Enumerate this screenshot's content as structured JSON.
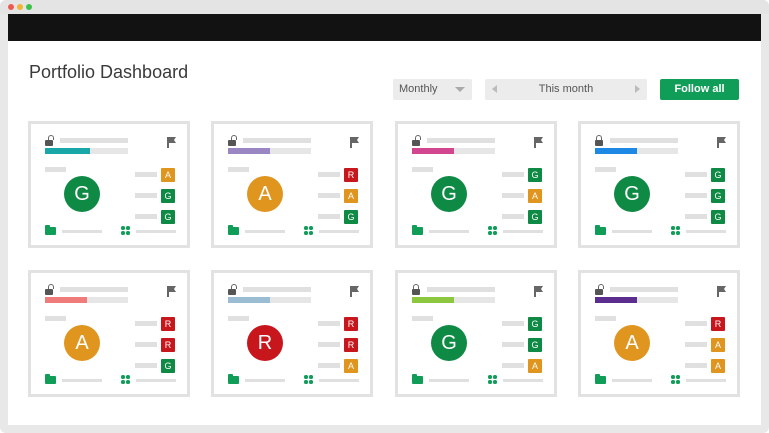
{
  "window": {
    "controls": [
      "close",
      "minimize",
      "maximize"
    ]
  },
  "page": {
    "title": "Portfolio Dashboard"
  },
  "toolbar": {
    "period_select": "Monthly",
    "month_nav_label": "This month",
    "follow_all_label": "Follow all"
  },
  "colors": {
    "G": "#0e8a44",
    "A": "#e0951f",
    "R": "#c8161d",
    "accent_green": "#0f9d58"
  },
  "projects": [
    {
      "lock": "open",
      "progress_color": "#1aa7a7",
      "progress": 0.54,
      "status": "G",
      "metrics": [
        "A",
        "G",
        "G"
      ]
    },
    {
      "lock": "open",
      "progress_color": "#9b86c4",
      "progress": 0.51,
      "status": "A",
      "metrics": [
        "R",
        "A",
        "G"
      ]
    },
    {
      "lock": "open",
      "progress_color": "#d1468e",
      "progress": 0.51,
      "status": "G",
      "metrics": [
        "G",
        "A",
        "G"
      ]
    },
    {
      "lock": "closed",
      "progress_color": "#1e88e5",
      "progress": 0.5,
      "status": "G",
      "metrics": [
        "G",
        "G",
        "G"
      ]
    },
    {
      "lock": "open",
      "progress_color": "#ef7b7b",
      "progress": 0.51,
      "status": "A",
      "metrics": [
        "R",
        "R",
        "G"
      ]
    },
    {
      "lock": "open",
      "progress_color": "#9bbdd4",
      "progress": 0.5,
      "status": "R",
      "metrics": [
        "R",
        "R",
        "A"
      ]
    },
    {
      "lock": "closed",
      "progress_color": "#8dc63f",
      "progress": 0.51,
      "status": "G",
      "metrics": [
        "G",
        "G",
        "A"
      ]
    },
    {
      "lock": "open",
      "progress_color": "#5b2d8e",
      "progress": 0.5,
      "status": "A",
      "metrics": [
        "R",
        "A",
        "A"
      ]
    }
  ]
}
